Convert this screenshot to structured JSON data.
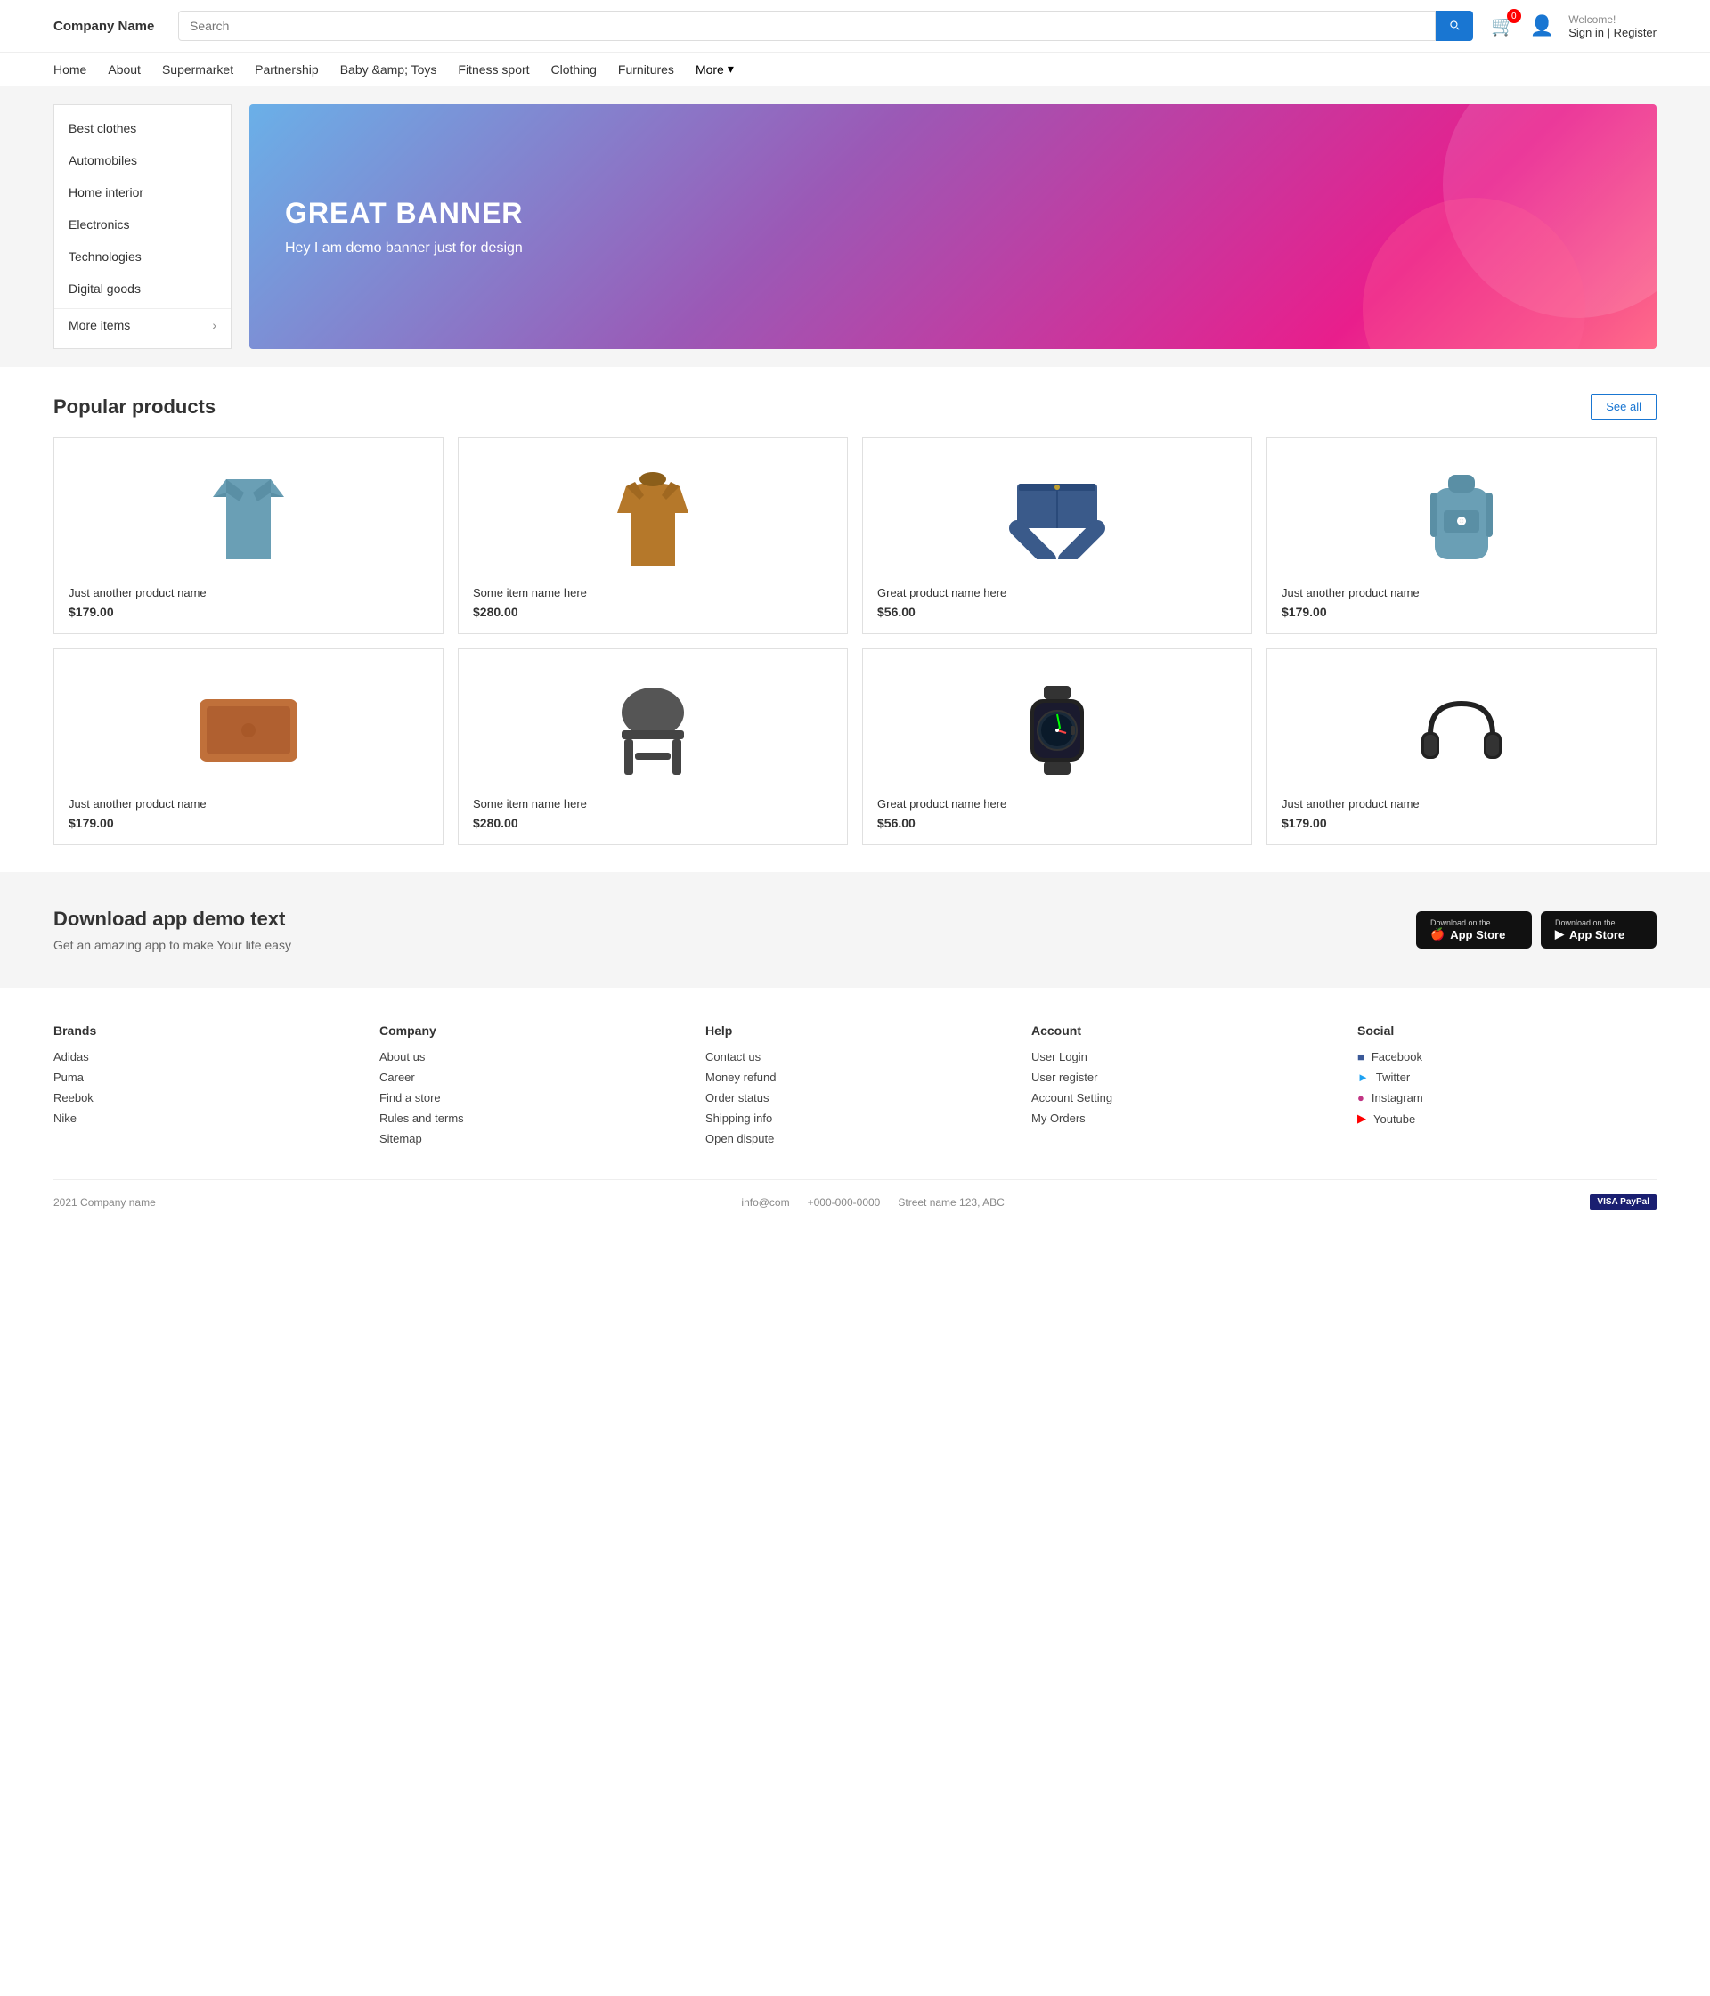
{
  "header": {
    "logo": "Company Name",
    "search_placeholder": "Search",
    "cart_count": "0",
    "welcome_text": "Welcome!",
    "sign_in_label": "Sign in | Register"
  },
  "nav": {
    "items": [
      {
        "label": "Home",
        "href": "#"
      },
      {
        "label": "About",
        "href": "#"
      },
      {
        "label": "Supermarket",
        "href": "#"
      },
      {
        "label": "Partnership",
        "href": "#"
      },
      {
        "label": "Baby &amp; Toys",
        "href": "#"
      },
      {
        "label": "Fitness sport",
        "href": "#"
      },
      {
        "label": "Clothing",
        "href": "#"
      },
      {
        "label": "Furnitures",
        "href": "#"
      }
    ],
    "more_label": "More"
  },
  "sidebar": {
    "title": "Best clothes",
    "items": [
      {
        "label": "Best clothes"
      },
      {
        "label": "Automobiles"
      },
      {
        "label": "Home interior"
      },
      {
        "label": "Electronics"
      },
      {
        "label": "Technologies"
      },
      {
        "label": "Digital goods"
      }
    ],
    "more_label": "More items"
  },
  "banner": {
    "title": "GREAT BANNER",
    "subtitle": "Hey I am demo banner just for design"
  },
  "products": {
    "section_title": "Popular products",
    "see_all_label": "See all",
    "items": [
      {
        "name": "Just another product name",
        "price": "$179.00",
        "type": "shirt"
      },
      {
        "name": "Some item name here",
        "price": "$280.00",
        "type": "jacket"
      },
      {
        "name": "Great product name here",
        "price": "$56.00",
        "type": "jeans"
      },
      {
        "name": "Just another product name",
        "price": "$179.00",
        "type": "backpack"
      },
      {
        "name": "Just another product name",
        "price": "$179.00",
        "type": "laptop"
      },
      {
        "name": "Some item name here",
        "price": "$280.00",
        "type": "chair"
      },
      {
        "name": "Great product name here",
        "price": "$56.00",
        "type": "watch"
      },
      {
        "name": "Just another product name",
        "price": "$179.00",
        "type": "headphones"
      }
    ]
  },
  "download": {
    "title": "Download app demo text",
    "subtitle": "Get an amazing app to make Your life easy",
    "app_store_top": "Download on the",
    "app_store_main": "App Store",
    "play_store_top": "Download on the",
    "play_store_main": "App Store"
  },
  "footer": {
    "brands": {
      "title": "Brands",
      "items": [
        "Adidas",
        "Puma",
        "Reebok",
        "Nike"
      ]
    },
    "company": {
      "title": "Company",
      "items": [
        "About us",
        "Career",
        "Find a store",
        "Rules and terms",
        "Sitemap"
      ]
    },
    "help": {
      "title": "Help",
      "items": [
        "Contact us",
        "Money refund",
        "Order status",
        "Shipping info",
        "Open dispute"
      ]
    },
    "account": {
      "title": "Account",
      "items": [
        "User Login",
        "User register",
        "Account Setting",
        "My Orders"
      ]
    },
    "social": {
      "title": "Social",
      "items": [
        {
          "label": "Facebook",
          "icon": "fb"
        },
        {
          "label": "Twitter",
          "icon": "tw"
        },
        {
          "label": "Instagram",
          "icon": "ig"
        },
        {
          "label": "Youtube",
          "icon": "yt"
        }
      ]
    }
  },
  "footer_bottom": {
    "copyright": "2021 Company name",
    "email": "info@com",
    "phone": "+000-000-0000",
    "address": "Street name 123, ABC",
    "payment": "VISA PayPal"
  }
}
